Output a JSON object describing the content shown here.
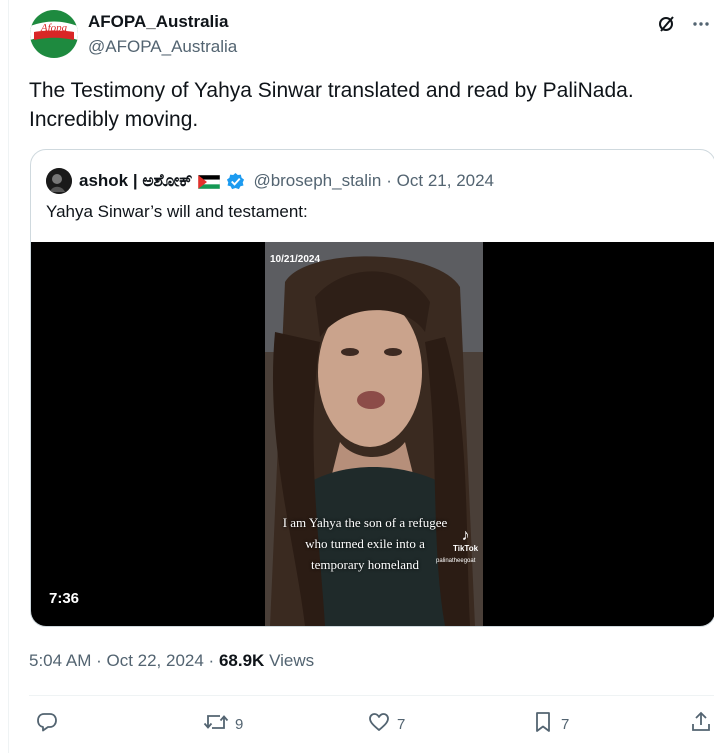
{
  "author": {
    "name": "AFOPA_Australia",
    "handle": "@AFOPA_Australia",
    "avatar_text": "Afopa"
  },
  "tweet": {
    "text": "The Testimony of Yahya Sinwar translated and read by PaliNada. Incredibly moving."
  },
  "quote": {
    "name": "ashok | ಅಶೋಕ್",
    "handle": "@broseph_stalin",
    "date": "· Oct 21, 2024",
    "text": "Yahya Sinwar’s will and testament:",
    "video": {
      "date_stamp": "10/21/2024",
      "caption_1": "I am Yahya the son of a refugee",
      "caption_2": "who turned exile into a",
      "caption_3": "temporary homeland",
      "watermark": "TikTok",
      "watermark_handle": "palinatheegoat",
      "duration": "7:36"
    }
  },
  "meta": {
    "time": "5:04 AM · Oct 22, 2024 ·",
    "views_count": "68.9K",
    "views_label": "Views"
  },
  "actions": {
    "retweets": "9",
    "likes": "7",
    "bookmarks": "7"
  },
  "colors": {
    "text": "#0f1419",
    "secondary": "#536471",
    "border": "#cfd9de",
    "verified": "#1d9bf0"
  }
}
